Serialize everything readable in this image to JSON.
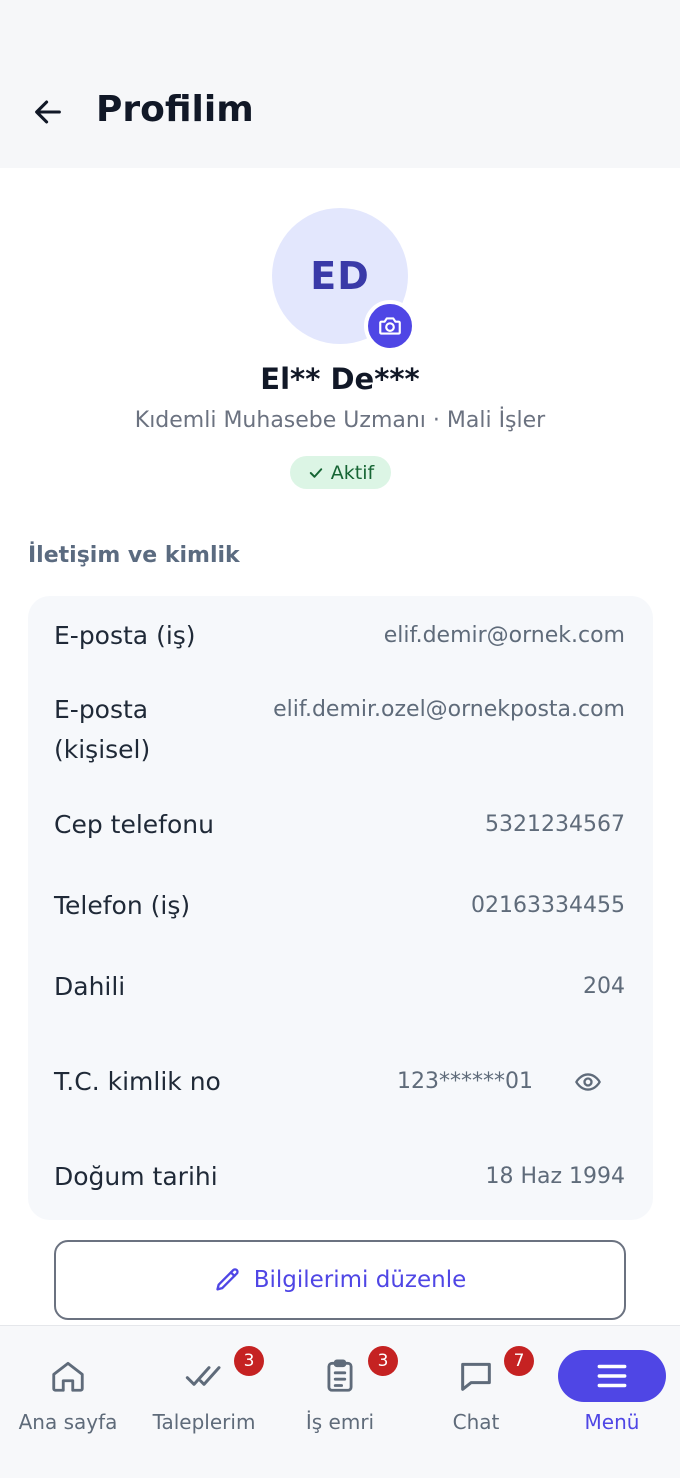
{
  "header": {
    "title": "Profilim"
  },
  "profile": {
    "initials": "ED",
    "name": "El** De***",
    "subtitle": "Kıdemli Muhasebe Uzmanı · Mali İşler",
    "status": "Aktif"
  },
  "section": {
    "title": "İletişim ve kimlik"
  },
  "fields": [
    {
      "label": "E-posta (iş)",
      "value": "elif.demir@ornek.com"
    },
    {
      "label": "E-posta (kişisel)",
      "value": "elif.demir.ozel@ornekposta.com"
    },
    {
      "label": "Cep telefonu",
      "value": "5321234567"
    },
    {
      "label": "Telefon (iş)",
      "value": "02163334455"
    },
    {
      "label": "Dahili",
      "value": "204"
    },
    {
      "label": "T.C. kimlik no",
      "value": "123******01"
    },
    {
      "label": "Doğum tarihi",
      "value": "18 Haz 1994"
    }
  ],
  "actions": {
    "edit_label": "Bilgilerimi düzenle"
  },
  "nav": {
    "items": [
      {
        "label": "Ana sayfa"
      },
      {
        "label": "Taleplerim",
        "badge": "3"
      },
      {
        "label": "İş emri",
        "badge": "3"
      },
      {
        "label": "Chat",
        "badge": "7"
      },
      {
        "label": "Menü"
      }
    ]
  },
  "colors": {
    "accent": "#4f46e5",
    "badge": "#c52222",
    "status_bg": "#dcf5e5",
    "status_text": "#166534"
  }
}
